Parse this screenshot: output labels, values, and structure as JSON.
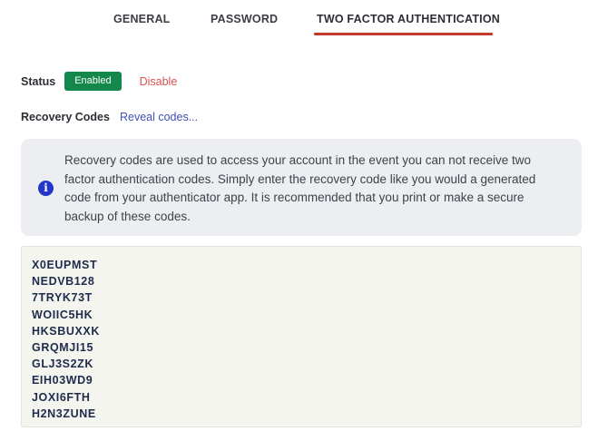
{
  "tabs": [
    {
      "label": "GENERAL",
      "active": false
    },
    {
      "label": "PASSWORD",
      "active": false
    },
    {
      "label": "TWO FACTOR AUTHENTICATION",
      "active": true
    }
  ],
  "status": {
    "label": "Status",
    "badge": "Enabled",
    "action": "Disable"
  },
  "recovery": {
    "label": "Recovery Codes",
    "reveal_link": "Reveal codes..."
  },
  "info": {
    "icon": "info-icon",
    "text": "Recovery codes are used to access your account in the event you can not receive two factor authentication codes. Simply enter the recovery code like you would a generated code from your authenticator app. It is recommended that you print or make a secure backup of these codes."
  },
  "codes": [
    "X0EUPMST",
    "NEDVB128",
    "7TRYK73T",
    "WOIIC5HK",
    "HKSBUXXK",
    "GRQMJI15",
    "GLJ3S2ZK",
    "EIH03WD9",
    "JOXI6FTH",
    "H2N3ZUNE"
  ],
  "colors": {
    "active_tab_underline": "#c0392b",
    "enabled_badge": "#14884a",
    "disable_link": "#d9534f",
    "reveal_link": "#3f51b5",
    "info_icon": "#2336c9",
    "info_box_bg": "#eceef2",
    "codes_box_bg": "#f5f5f0"
  }
}
